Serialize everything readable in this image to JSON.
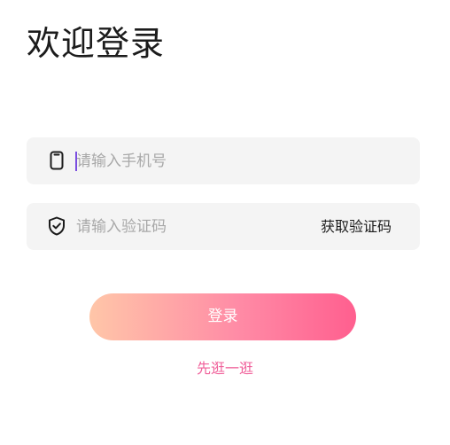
{
  "header": {
    "title": "欢迎登录"
  },
  "phone_field": {
    "icon": "phone-icon",
    "placeholder": "请输入手机号",
    "value": ""
  },
  "code_field": {
    "icon": "shield-check-icon",
    "placeholder": "请输入验证码",
    "value": "",
    "get_code_label": "获取验证码"
  },
  "login_button": {
    "label": "登录"
  },
  "browse_link": {
    "label": "先逛一逛"
  },
  "colors": {
    "field_background": "#f4f4f4",
    "caret": "#7b4fe0",
    "button_gradient_start": "#ffc6a8",
    "button_gradient_end": "#ff5f8f",
    "link": "#f0609a"
  }
}
